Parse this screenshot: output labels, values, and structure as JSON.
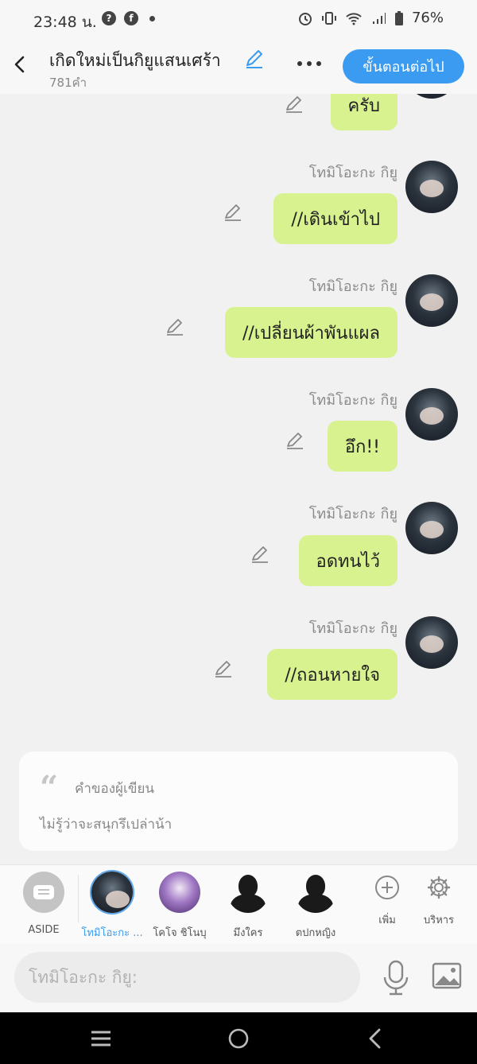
{
  "status": {
    "time": "23:48 น.",
    "battery": "76%"
  },
  "header": {
    "title": "เกิดใหม่เป็นกิยูแสนเศร้า",
    "word_count": "781คำ",
    "next_label": "ขั้นตอนต่อไป"
  },
  "messages": [
    {
      "speaker": "",
      "text": "ครับ"
    },
    {
      "speaker": "โทมิโอะกะ กิยู",
      "text": "//เดินเข้าไป"
    },
    {
      "speaker": "โทมิโอะกะ กิยู",
      "text": "//เปลี่ยนผ้าพันแผล"
    },
    {
      "speaker": "โทมิโอะกะ กิยู",
      "text": "อึก!!"
    },
    {
      "speaker": "โทมิโอะกะ กิยู",
      "text": "อดทนไว้"
    },
    {
      "speaker": "โทมิโอะกะ กิยู",
      "text": "//ถอนหายใจ"
    }
  ],
  "author_note": {
    "label": "คำของผู้เขียน",
    "text": "ไม่รู้ว่าจะสนุกรึเปล่าน้า"
  },
  "characters": {
    "aside": "ASIDE",
    "list": [
      "โทมิโอะกะ ...",
      "โคโจ ชิโนบุ",
      "มึงใคร",
      "ตปกหญิง"
    ],
    "add_label": "เพิ่ม",
    "manage_label": "บริหาร"
  },
  "input": {
    "placeholder": "โทมิโอะกะ กิยู:"
  },
  "colors": {
    "accent": "#3a9bf0",
    "bubble": "#d7f28e"
  }
}
